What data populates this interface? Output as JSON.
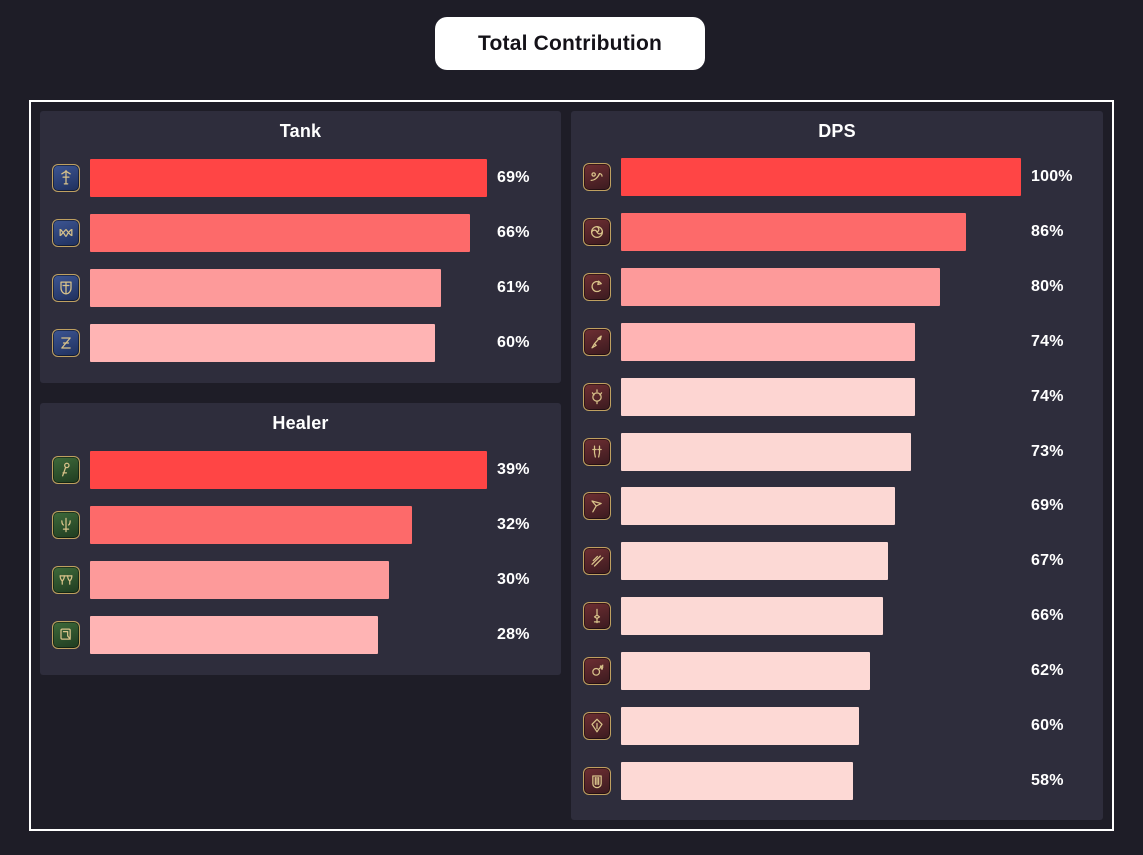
{
  "header": {
    "title": "Total Contribution"
  },
  "colors": {
    "page_background": "#1e1d27",
    "panel_background": "#2e2d3c",
    "board_border": "#ffffff",
    "title_pill_background": "#ffffff",
    "title_pill_text": "#141218",
    "text": "#ffffff",
    "icon_border": "#bfa060",
    "bar_ramp": [
      "#ff4545",
      "#fd6a6a",
      "#fd9a9a",
      "#ffb4b4",
      "#fdd5d2",
      "#fcd7d3",
      "#fcd8d4",
      "#fcd9d5",
      "#fcd9d5",
      "#fdd9d5",
      "#fdd9d5",
      "#fdd9d5"
    ]
  },
  "chart_data": {
    "type": "bar",
    "title": "Total Contribution",
    "xlabel": "",
    "ylabel": "",
    "value_suffix": "%",
    "orientation": "horizontal",
    "grid": false,
    "legend": "none",
    "panels": [
      {
        "id": "tank",
        "title": "Tank",
        "role": "tank",
        "ylim": [
          0,
          69
        ],
        "categories": [
          "paladin",
          "warrior",
          "dark-knight",
          "gunbreaker"
        ],
        "values": [
          69,
          66,
          61,
          60
        ],
        "labels": [
          "69%",
          "66%",
          "61%",
          "60%"
        ],
        "bars": [
          {
            "icon": "paladin-icon",
            "value": 69,
            "label": "69%",
            "bar_pct": 100.0,
            "color": "#ff4545"
          },
          {
            "icon": "warrior-icon",
            "value": 66,
            "label": "66%",
            "bar_pct": 95.6,
            "color": "#fd6a6a"
          },
          {
            "icon": "dark-knight-icon",
            "value": 61,
            "label": "61%",
            "bar_pct": 88.4,
            "color": "#fd9a9a"
          },
          {
            "icon": "gunbreaker-icon",
            "value": 60,
            "label": "60%",
            "bar_pct": 86.9,
            "color": "#ffb4b4"
          }
        ]
      },
      {
        "id": "healer",
        "title": "Healer",
        "role": "healer",
        "ylim": [
          0,
          39
        ],
        "categories": [
          "white-mage",
          "scholar",
          "astrologian",
          "sage"
        ],
        "values": [
          39,
          32,
          30,
          28
        ],
        "labels": [
          "39%",
          "32%",
          "30%",
          "28%"
        ],
        "bars": [
          {
            "icon": "white-mage-icon",
            "value": 39,
            "label": "39%",
            "bar_pct": 100.0,
            "color": "#ff4545"
          },
          {
            "icon": "scholar-icon",
            "value": 32,
            "label": "32%",
            "bar_pct": 81.0,
            "color": "#fd6a6a"
          },
          {
            "icon": "astrologian-icon",
            "value": 30,
            "label": "30%",
            "bar_pct": 75.4,
            "color": "#fd9a9a"
          },
          {
            "icon": "sage-icon",
            "value": 28,
            "label": "28%",
            "bar_pct": 72.6,
            "color": "#ffb4b4"
          }
        ]
      },
      {
        "id": "dps",
        "title": "DPS",
        "role": "dps",
        "ylim": [
          0,
          100
        ],
        "categories": [
          "reaper",
          "machinist",
          "ninja",
          "dragoon",
          "monk",
          "samurai",
          "dancer",
          "viper",
          "black-mage",
          "red-mage",
          "pictomancer",
          "bard"
        ],
        "values": [
          100,
          86,
          80,
          74,
          74,
          73,
          69,
          67,
          66,
          62,
          60,
          58
        ],
        "labels": [
          "100%",
          "86%",
          "80%",
          "74%",
          "74%",
          "73%",
          "69%",
          "67%",
          "66%",
          "62%",
          "60%",
          "58%"
        ],
        "bars": [
          {
            "icon": "reaper-icon",
            "value": 100,
            "label": "100%",
            "bar_pct": 100.0,
            "color": "#ff4545"
          },
          {
            "icon": "machinist-icon",
            "value": 86,
            "label": "86%",
            "bar_pct": 86.2,
            "color": "#fd6a6a"
          },
          {
            "icon": "ninja-icon",
            "value": 80,
            "label": "80%",
            "bar_pct": 79.7,
            "color": "#fd9a9a"
          },
          {
            "icon": "dragoon-icon",
            "value": 74,
            "label": "74%",
            "bar_pct": 73.4,
            "color": "#ffb4b4"
          },
          {
            "icon": "monk-icon",
            "value": 74,
            "label": "74%",
            "bar_pct": 73.4,
            "color": "#fdd5d2"
          },
          {
            "icon": "samurai-icon",
            "value": 73,
            "label": "73%",
            "bar_pct": 72.4,
            "color": "#fcd7d3"
          },
          {
            "icon": "dancer-icon",
            "value": 69,
            "label": "69%",
            "bar_pct": 68.5,
            "color": "#fcd8d4"
          },
          {
            "icon": "viper-icon",
            "value": 67,
            "label": "67%",
            "bar_pct": 66.7,
            "color": "#fcd9d5"
          },
          {
            "icon": "black-mage-icon",
            "value": 66,
            "label": "66%",
            "bar_pct": 65.6,
            "color": "#fcd9d5"
          },
          {
            "icon": "red-mage-icon",
            "value": 62,
            "label": "62%",
            "bar_pct": 62.2,
            "color": "#fdd9d5"
          },
          {
            "icon": "pictomancer-icon",
            "value": 60,
            "label": "60%",
            "bar_pct": 59.4,
            "color": "#fdd9d5"
          },
          {
            "icon": "bard-icon",
            "value": 58,
            "label": "58%",
            "bar_pct": 58.1,
            "color": "#fdd9d5"
          }
        ]
      }
    ]
  }
}
